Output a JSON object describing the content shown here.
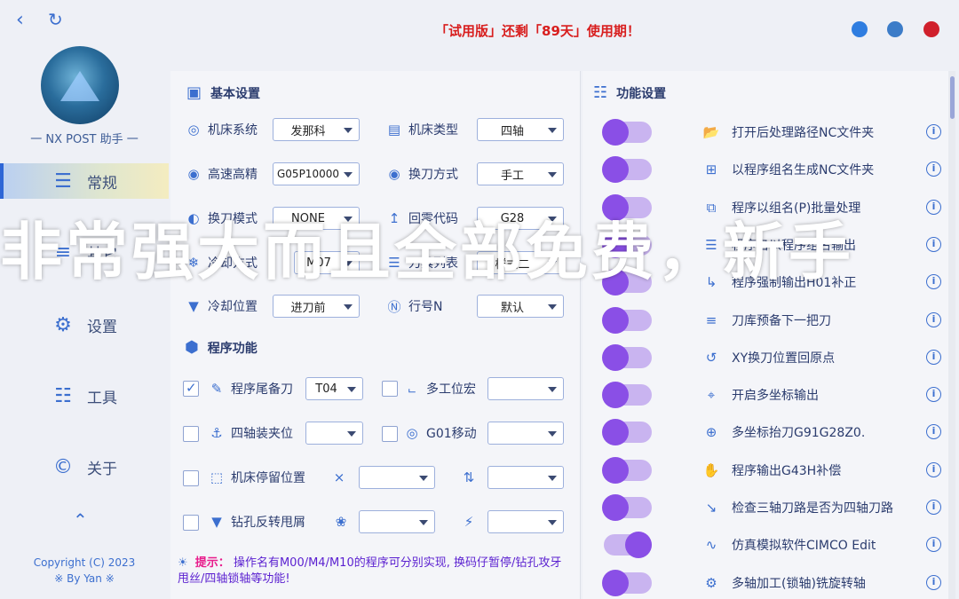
{
  "title_banner": "「试用版」还剩「89天」使用期！",
  "brand": "一 NX POST 助手 一",
  "sidebar": {
    "items": [
      {
        "label": "常规",
        "icon": "layers-icon",
        "active": true
      },
      {
        "label": "其它",
        "icon": "list-icon"
      },
      {
        "label": "设置",
        "icon": "gear-icon"
      },
      {
        "label": "工具",
        "icon": "sliders-icon"
      },
      {
        "label": "关于",
        "icon": "copyright-icon"
      }
    ],
    "copyright_line1": "Copyright (C) 2023",
    "copyright_line2": "※ By Yan ※"
  },
  "window_buttons": {
    "back_color": "#2f7de0",
    "min_color": "#3c7cc8",
    "close_color": "#d0202c"
  },
  "basic": {
    "title": "基本设置",
    "rows": [
      {
        "label": "机床系统",
        "value": "发那科",
        "label2": "机床类型",
        "value2": "四轴"
      },
      {
        "label": "高速高精",
        "value": "G05P10000",
        "label2": "换刀方式",
        "value2": "手工"
      },
      {
        "label": "换刀模式",
        "value": "NONE",
        "label2": "回零代码",
        "value2": "G28"
      },
      {
        "label": "冷却方式",
        "value": "M07",
        "label2": "刀具列表",
        "value2": "样式二"
      },
      {
        "label": "冷却位置",
        "value": "进刀前",
        "label2": "行号N",
        "value2": "默认"
      }
    ]
  },
  "program": {
    "title": "程序功能",
    "rows": [
      {
        "label": "程序尾备刀",
        "checked": true,
        "value": "T04",
        "label2": "多工位宏",
        "value2": ""
      },
      {
        "label": "四轴装夹位",
        "checked": false,
        "value": "",
        "label2": "G01移动",
        "value2": ""
      },
      {
        "label": "机床停留位置",
        "checked": false,
        "value": "",
        "value2": ""
      },
      {
        "label": "钻孔反转甩屑",
        "checked": false,
        "value": "",
        "value2": ""
      }
    ],
    "extra_selects": [
      "",
      "",
      ""
    ]
  },
  "tip": {
    "head": "提示：",
    "body": "操作名有M00/M4/M10的程序可分别实现, 换码仔暂停/钻孔攻牙甩丝/四轴锁轴等功能!"
  },
  "functions": {
    "title": "功能设置",
    "items": [
      {
        "label": "打开后处理路径NC文件夹",
        "on": false
      },
      {
        "label": "以程序组名生成NC文件夹",
        "on": false
      },
      {
        "label": "程序以组名(P)批量处理",
        "on": false
      },
      {
        "label": "程序名以程序组名输出",
        "on": false
      },
      {
        "label": "程序强制输出H01补正",
        "on": false
      },
      {
        "label": "刀库预备下一把刀",
        "on": false
      },
      {
        "label": "XY换刀位置回原点",
        "on": false
      },
      {
        "label": "开启多坐标输出",
        "on": false
      },
      {
        "label": "多坐标抬刀G91G28Z0.",
        "on": false
      },
      {
        "label": "程序输出G43H补偿",
        "on": false
      },
      {
        "label": "检查三轴刀路是否为四轴刀路",
        "on": false
      },
      {
        "label": "仿真模拟软件CIMCO Edit",
        "on": true
      },
      {
        "label": "多轴加工(锁轴)铣旋转轴",
        "on": false
      }
    ]
  },
  "overlay_text": "非常强大而且全部免费，新手"
}
